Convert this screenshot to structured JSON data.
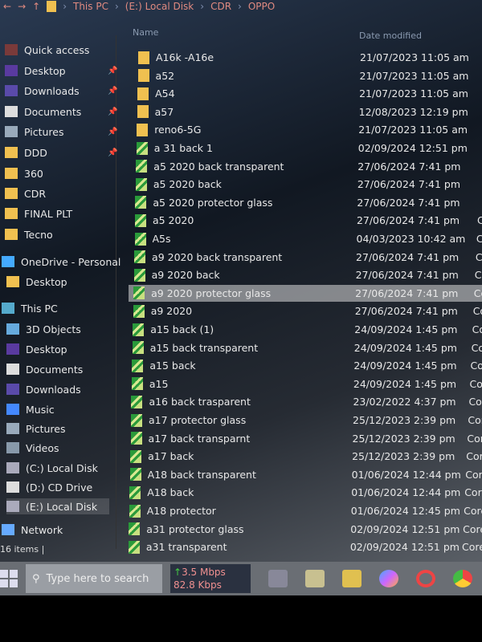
{
  "address": {
    "crumbs": [
      "This PC",
      "(E:) Local Disk",
      "CDR",
      "OPPO"
    ]
  },
  "header": {
    "name": "Name",
    "date": "Date modified"
  },
  "sidebar": [
    {
      "label": "Quick access",
      "icon": "star-icon"
    },
    {
      "label": "Desktop",
      "icon": "desktop-icon",
      "pinned": true
    },
    {
      "label": "Downloads",
      "icon": "download-icon",
      "pinned": true
    },
    {
      "label": "Documents",
      "icon": "document-icon",
      "pinned": true
    },
    {
      "label": "Pictures",
      "icon": "pictures-icon",
      "pinned": true
    },
    {
      "label": "DDD",
      "icon": "folder-icon",
      "pinned": true
    },
    {
      "label": "360",
      "icon": "folder-icon"
    },
    {
      "label": "CDR",
      "icon": "folder-icon"
    },
    {
      "label": "FINAL PLT",
      "icon": "folder-icon"
    },
    {
      "label": "Tecno",
      "icon": "folder-icon"
    },
    {
      "label": "OneDrive - Personal",
      "icon": "cloud-icon"
    },
    {
      "label": "Desktop",
      "icon": "folder-icon"
    },
    {
      "label": "This PC",
      "icon": "computer-icon"
    },
    {
      "label": "3D Objects",
      "icon": "cube-icon"
    },
    {
      "label": "Desktop",
      "icon": "desktop-icon"
    },
    {
      "label": "Documents",
      "icon": "document-icon"
    },
    {
      "label": "Downloads",
      "icon": "download-icon"
    },
    {
      "label": "Music",
      "icon": "music-icon"
    },
    {
      "label": "Pictures",
      "icon": "pictures-icon"
    },
    {
      "label": "Videos",
      "icon": "video-icon"
    },
    {
      "label": "(C:) Local Disk",
      "icon": "drive-icon"
    },
    {
      "label": "(D:) CD Drive",
      "icon": "cd-icon"
    },
    {
      "label": "(E:) Local Disk",
      "icon": "drive-icon",
      "selected": true
    },
    {
      "label": "Network",
      "icon": "network-icon"
    }
  ],
  "files": [
    {
      "name": "A16k -A16e",
      "date": "21/07/2023 11:05 am",
      "kind": "folder"
    },
    {
      "name": "a52",
      "date": "21/07/2023 11:05 am",
      "kind": "folder"
    },
    {
      "name": "A54",
      "date": "21/07/2023 11:05 am",
      "kind": "folder"
    },
    {
      "name": "a57",
      "date": "12/08/2023 12:19 pm",
      "kind": "folder"
    },
    {
      "name": "reno6-5G",
      "date": "21/07/2023 11:05 am",
      "kind": "folder"
    },
    {
      "name": "a 31 back 1",
      "date": "02/09/2024 12:51 pm",
      "kind": "cdr"
    },
    {
      "name": "a5 2020 back transparent",
      "date": "27/06/2024 7:41 pm",
      "kind": "cdr"
    },
    {
      "name": "a5 2020 back",
      "date": "27/06/2024 7:41 pm",
      "kind": "cdr"
    },
    {
      "name": "a5 2020 protector glass",
      "date": "27/06/2024 7:41 pm",
      "kind": "cdr"
    },
    {
      "name": "a5 2020",
      "date": "27/06/2024 7:41 pm",
      "kind": "cdr"
    },
    {
      "name": "A5s",
      "date": "04/03/2023 10:42 am",
      "kind": "cdr"
    },
    {
      "name": "a9 2020 back transparent",
      "date": "27/06/2024 7:41 pm",
      "kind": "cdr"
    },
    {
      "name": "a9 2020 back",
      "date": "27/06/2024 7:41 pm",
      "kind": "cdr"
    },
    {
      "name": "a9 2020 protector glass",
      "date": "27/06/2024 7:41 pm",
      "kind": "cdr",
      "selected": true
    },
    {
      "name": "a9 2020",
      "date": "27/06/2024 7:41 pm",
      "kind": "cdr"
    },
    {
      "name": "a15 back (1)",
      "date": "24/09/2024 1:45 pm",
      "kind": "cdr"
    },
    {
      "name": "a15 back transparent",
      "date": "24/09/2024 1:45 pm",
      "kind": "cdr"
    },
    {
      "name": "a15 back",
      "date": "24/09/2024 1:45 pm",
      "kind": "cdr"
    },
    {
      "name": "a15",
      "date": "24/09/2024 1:45 pm",
      "kind": "cdr"
    },
    {
      "name": "a16 back trasparent",
      "date": "23/02/2022 4:37 pm",
      "kind": "cdr"
    },
    {
      "name": "a17  protector glass",
      "date": "25/12/2023 2:39 pm",
      "kind": "cdr"
    },
    {
      "name": "a17 back transparnt",
      "date": "25/12/2023 2:39 pm",
      "kind": "cdr"
    },
    {
      "name": "a17 back",
      "date": "25/12/2023 2:39 pm",
      "kind": "cdr"
    },
    {
      "name": "A18 back transparent",
      "date": "01/06/2024 12:44 pm",
      "kind": "cdr"
    },
    {
      "name": "A18 back",
      "date": "01/06/2024 12:44 pm",
      "kind": "cdr"
    },
    {
      "name": "A18 protector",
      "date": "01/06/2024 12:45 pm",
      "kind": "cdr"
    },
    {
      "name": "a31 protector glass",
      "date": "02/09/2024 12:51 pm",
      "kind": "cdr"
    },
    {
      "name": "a31 transparent",
      "date": "02/09/2024 12:51 pm",
      "kind": "cdr"
    }
  ],
  "type_fragment": "Core",
  "status": {
    "count": "16 items |"
  },
  "taskbar": {
    "search_placeholder": "Type here to search",
    "upload": "3.5 Mbps",
    "download": "82.8 Kbps"
  }
}
